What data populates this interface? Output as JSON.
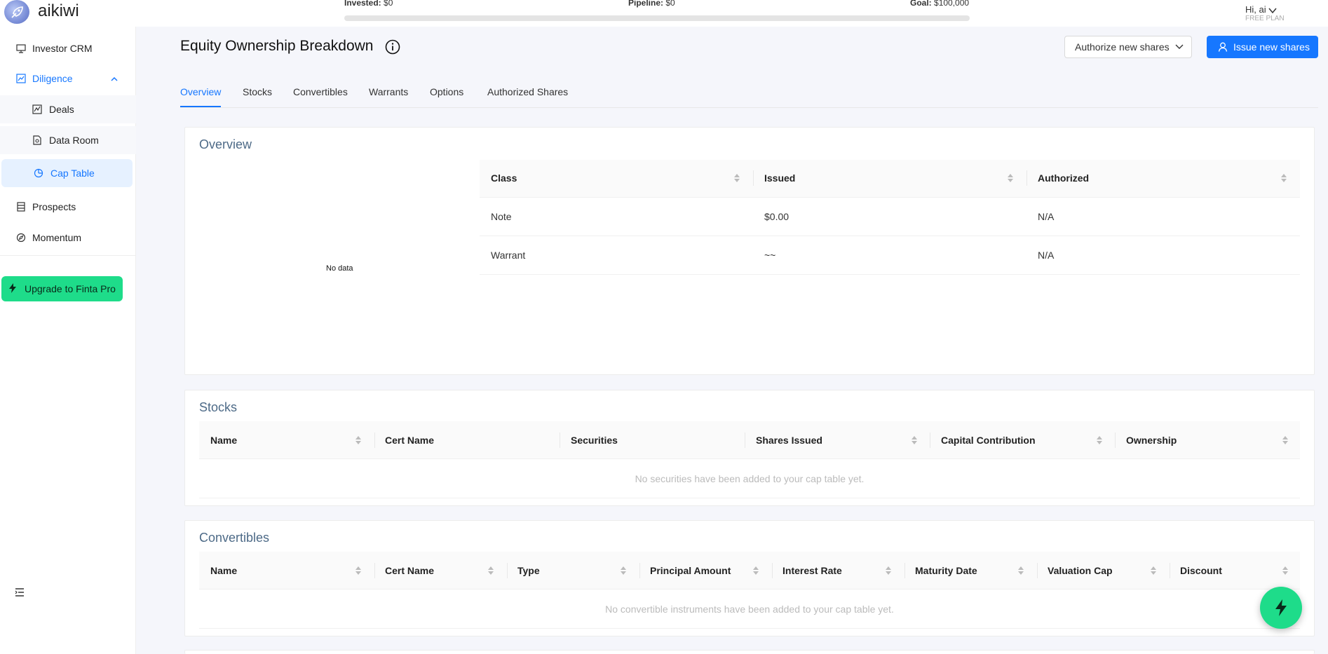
{
  "app": {
    "brand": "aikiwi"
  },
  "header": {
    "invested_label": "Invested:",
    "invested_value": "$0",
    "pipeline_label": "Pipeline:",
    "pipeline_value": "$0",
    "goal_label": "Goal:",
    "goal_value": "$100,000",
    "progress_fraction": 0,
    "greeting": "Hi, ai",
    "plan": "FREE PLAN"
  },
  "sidebar": {
    "items": [
      {
        "label": "Investor CRM",
        "icon": "monitor-icon"
      },
      {
        "label": "Diligence",
        "icon": "line-chart-icon"
      },
      {
        "label": "Deals",
        "icon": "stock-chart-icon"
      },
      {
        "label": "Data Room",
        "icon": "file-search-icon"
      },
      {
        "label": "Cap Table",
        "icon": "pie-chart-icon"
      },
      {
        "label": "Prospects",
        "icon": "list-icon"
      },
      {
        "label": "Momentum",
        "icon": "compass-icon"
      }
    ],
    "upgrade_label": "Upgrade to Finta Pro"
  },
  "page": {
    "title": "Equity Ownership Breakdown",
    "authorize_label": "Authorize new shares",
    "issue_label": "Issue new shares",
    "tabs": [
      "Overview",
      "Stocks",
      "Convertibles",
      "Warrants",
      "Options",
      "Authorized Shares"
    ],
    "active_tab": "Overview"
  },
  "overview": {
    "title": "Overview",
    "chart_empty": "No data",
    "columns": [
      "Class",
      "Issued",
      "Authorized"
    ],
    "rows": [
      {
        "class": "Note",
        "issued": "$0.00",
        "authorized": "N/A"
      },
      {
        "class": "Warrant",
        "issued": "~~",
        "authorized": "N/A"
      }
    ]
  },
  "stocks": {
    "title": "Stocks",
    "columns": [
      "Name",
      "Cert Name",
      "Securities",
      "Shares Issued",
      "Capital Contribution",
      "Ownership"
    ],
    "empty": "No securities have been added to your cap table yet."
  },
  "convertibles": {
    "title": "Convertibles",
    "columns": [
      "Name",
      "Cert Name",
      "Type",
      "Principal Amount",
      "Interest Rate",
      "Maturity Date",
      "Valuation Cap",
      "Discount"
    ],
    "empty": "No convertible instruments have been added to your cap table yet."
  },
  "colors": {
    "accent": "#1677ff",
    "upgrade": "#1edc8a",
    "card_title": "#4d6a87"
  }
}
